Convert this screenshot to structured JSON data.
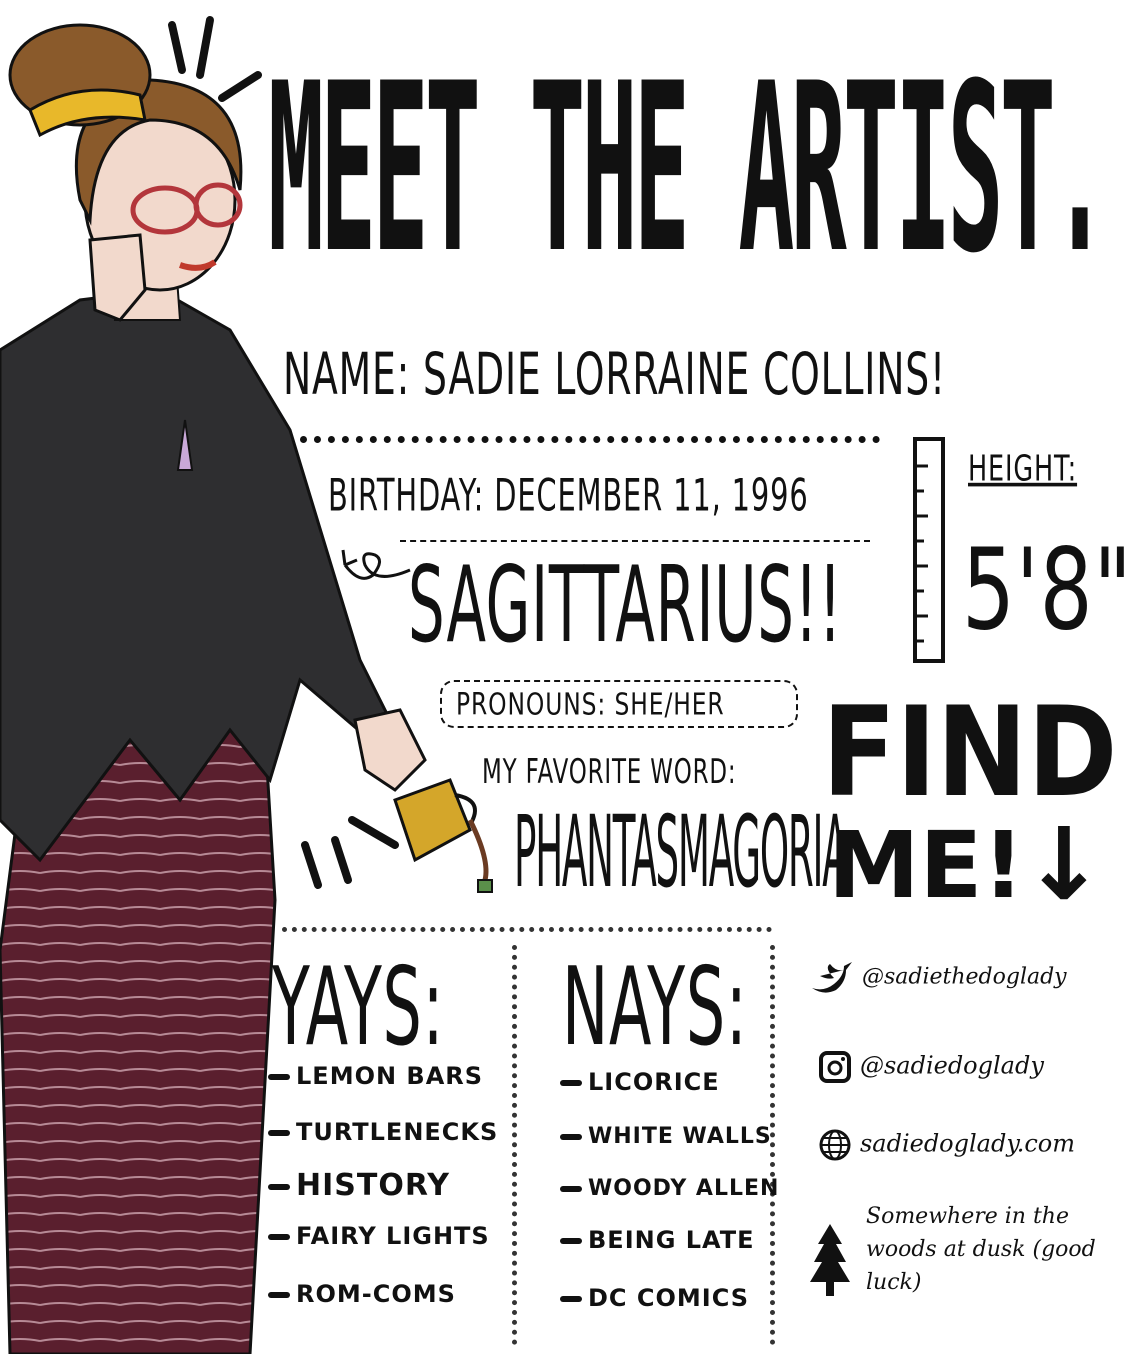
{
  "title": "MEET THE ARTIST.",
  "name_line": "NAME: SADIE LORRAINE COLLINS!",
  "birthday_line": "BIRTHDAY: DECEMBER 11, 1996",
  "sign": "SAGITTARIUS!!",
  "height_label": "HEIGHT:",
  "height_value": "5'8\"",
  "pronouns": "PRONOUNS: SHE/HER",
  "favorite_word_label": "MY FAVORITE WORD:",
  "favorite_word": "PHANTASMAGORIA",
  "find_me": {
    "line1": "FIND",
    "line2": "ME!",
    "arrow": "↓"
  },
  "yays": {
    "heading": "YAYS:",
    "items": [
      "LEMON BARS",
      "TURTLENECKS",
      "HISTORY",
      "FAIRY LIGHTS",
      "ROM-COMS"
    ]
  },
  "nays": {
    "heading": "NAYS:",
    "items": [
      "LICORICE",
      "WHITE WALLS",
      "WOODY ALLEN",
      "BEING LATE",
      "DC COMICS"
    ]
  },
  "socials": [
    {
      "icon": "twitter-icon",
      "text": "@sadiethedoglady"
    },
    {
      "icon": "instagram-icon",
      "text": "@sadiedoglady"
    },
    {
      "icon": "globe-icon",
      "text": "sadiedoglady.com"
    },
    {
      "icon": "tree-icon",
      "text": "Somewhere in the woods at dusk (good luck)"
    }
  ],
  "colors": {
    "ink": "#111111",
    "sweater": "#2e2e30",
    "pants": "#5a1f2e",
    "pants_stripe": "#b78a96",
    "hair": "#8a5a2b",
    "scrunchie": "#e8b82a",
    "mug": "#d4a62a",
    "skin": "#f2d9cc"
  }
}
